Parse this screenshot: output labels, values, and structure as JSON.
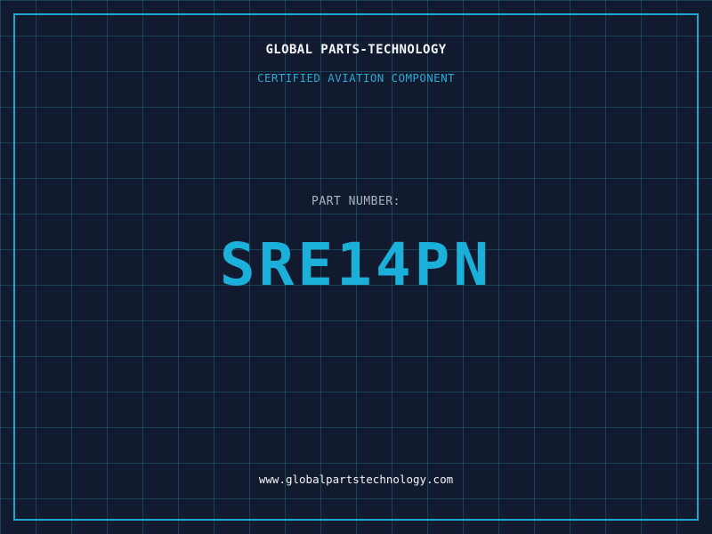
{
  "header": {
    "brand": "GLOBAL PARTS-TECHNOLOGY",
    "tagline": "CERTIFIED AVIATION COMPONENT"
  },
  "part": {
    "label": "PART NUMBER:",
    "number": "SRE14PN"
  },
  "footer": {
    "url": "www.globalpartstechnology.com"
  },
  "colors": {
    "background": "#111a2e",
    "grid": "#1e5f73",
    "accent": "#1ab0da",
    "text": "#f2f4f8",
    "label": "#aab4c4"
  }
}
